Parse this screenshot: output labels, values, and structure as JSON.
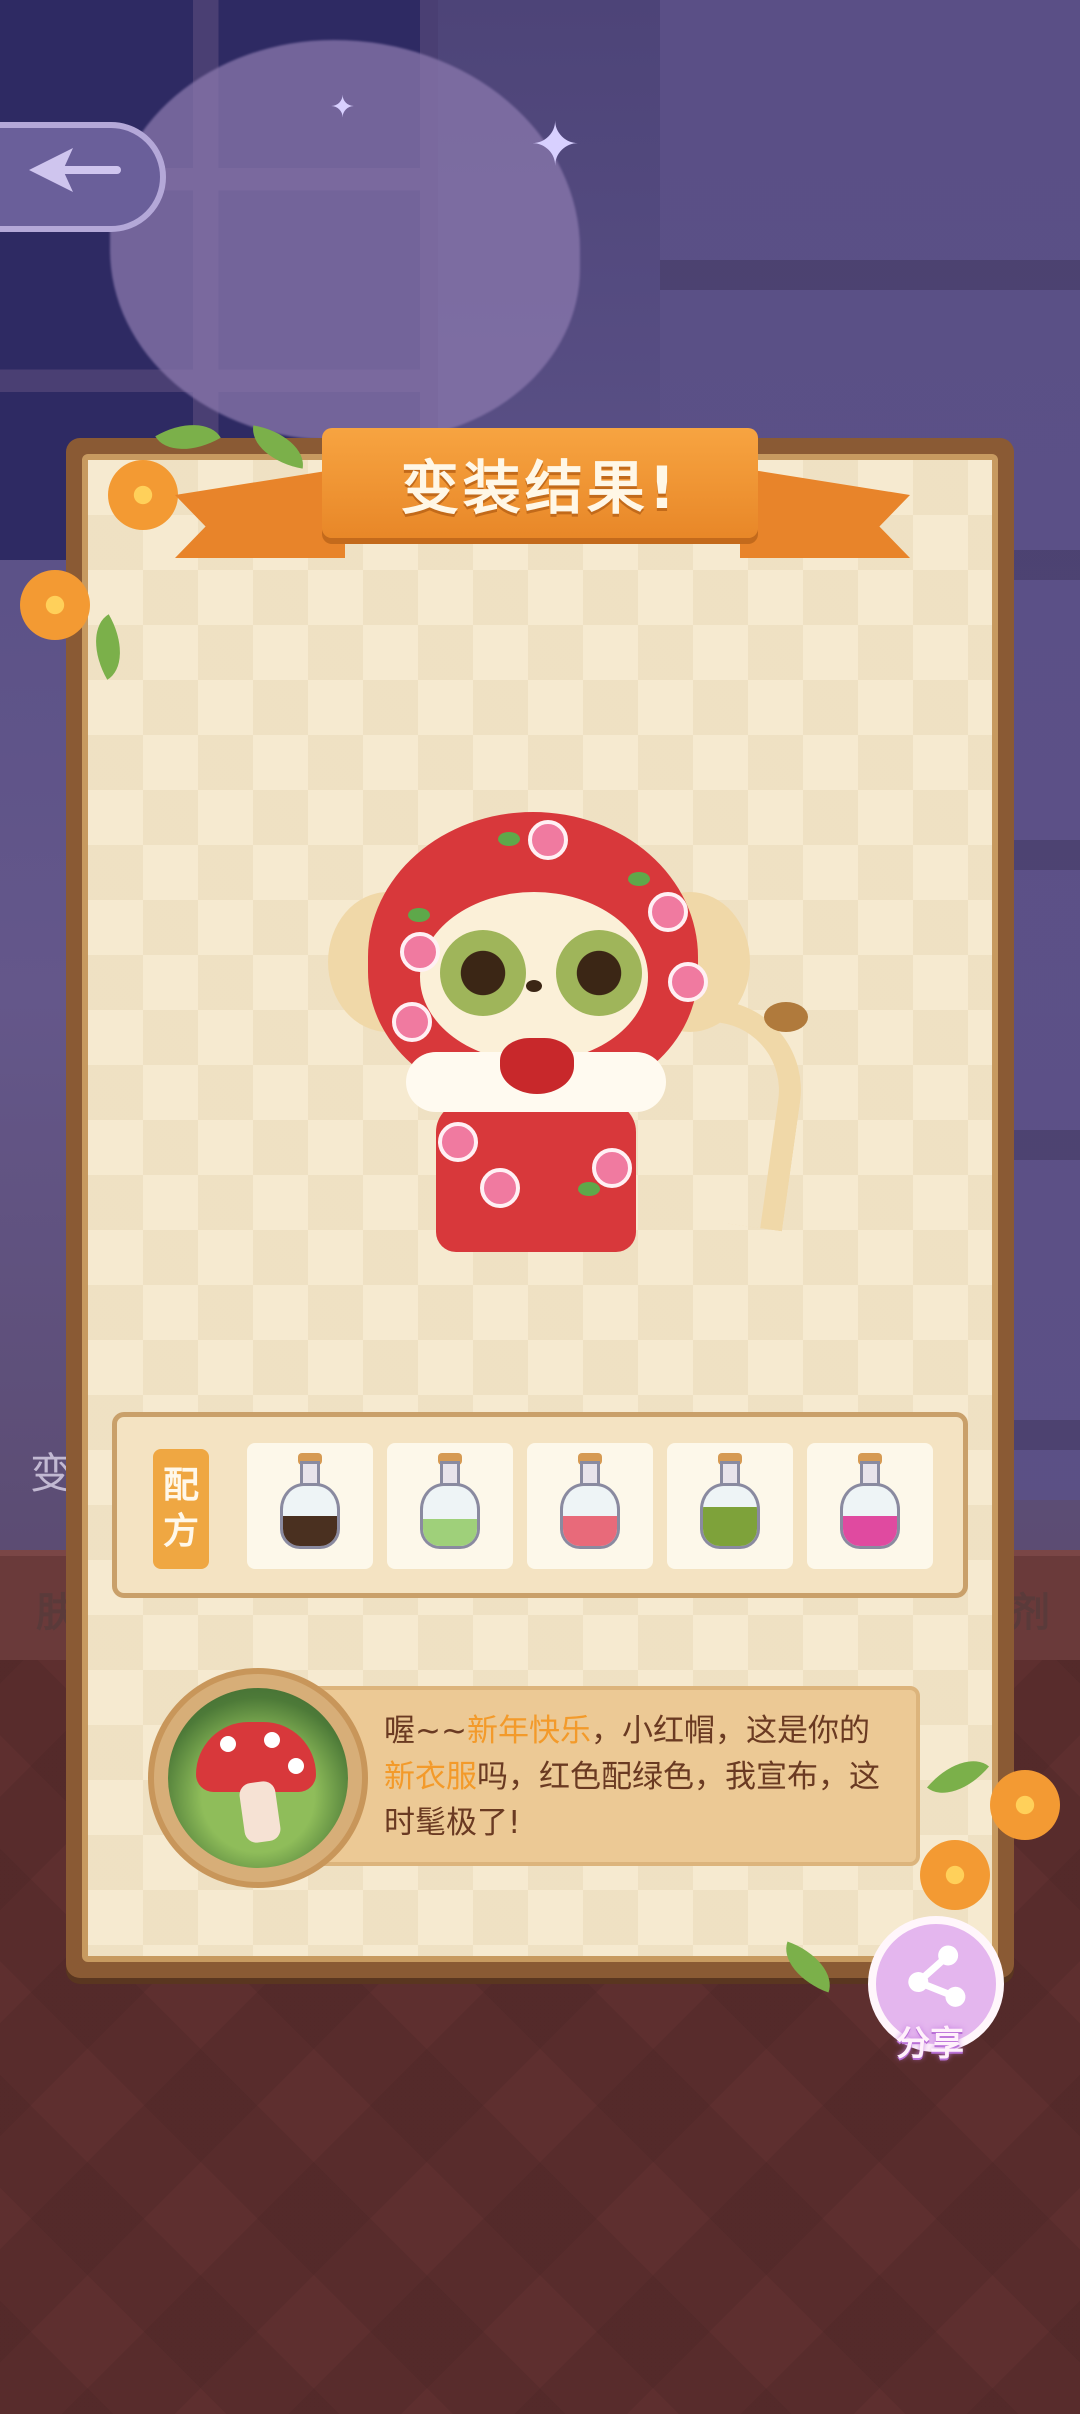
{
  "title": "变装结果!",
  "recipe": {
    "label_chars": [
      "配",
      "方"
    ],
    "potions": [
      {
        "icon": "potion-dark-icon",
        "color": "#4a3020"
      },
      {
        "icon": "potion-green-light-icon",
        "color": "#9fd07a"
      },
      {
        "icon": "potion-pink-icon",
        "color": "#e86a7a"
      },
      {
        "icon": "potion-green-icon",
        "color": "#7ea23a"
      },
      {
        "icon": "potion-magenta-icon",
        "color": "#e04aa0"
      }
    ]
  },
  "dialog": {
    "part1": "喔~~",
    "highlight1": "新年快乐",
    "part2": "，小红帽，这是你的",
    "highlight2": "新衣服",
    "part3": "吗，红色配绿色，我宣布，这时髦极了!"
  },
  "share": {
    "label": "分享"
  },
  "background": {
    "left_label": "变",
    "bottom_left": "肤",
    "bottom_right": "剂"
  },
  "colors": {
    "accent": "#f39a2a",
    "ribbon": "#e8842a",
    "panel": "#f6ead0",
    "share": "#e4b6ee"
  }
}
